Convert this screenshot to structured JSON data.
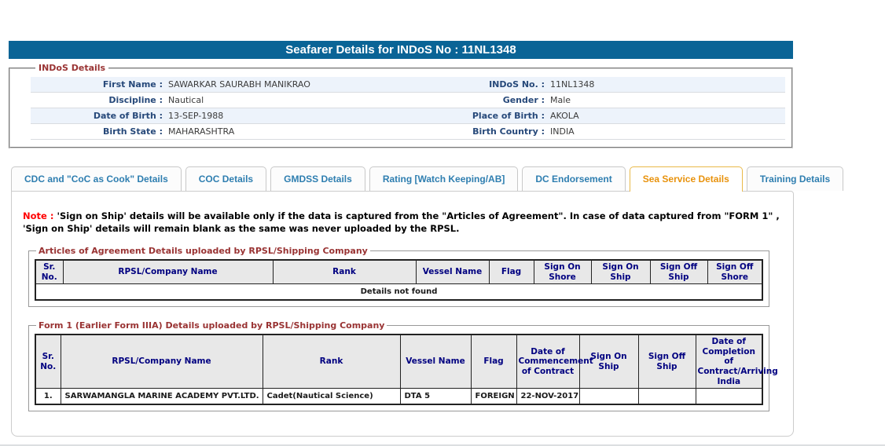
{
  "page": {
    "title": "Seafarer Details for INDoS No : 11NL1348"
  },
  "indos_details": {
    "legend": "INDoS Details",
    "rows": [
      {
        "left_label": "First Name :",
        "left_value": "SAWARKAR SAURABH MANIKRAO",
        "right_label": "INDoS No. :",
        "right_value": "11NL1348"
      },
      {
        "left_label": "Discipline :",
        "left_value": "Nautical",
        "right_label": "Gender :",
        "right_value": "Male"
      },
      {
        "left_label": "Date of Birth :",
        "left_value": "13-SEP-1988",
        "right_label": "Place of Birth :",
        "right_value": "AKOLA"
      },
      {
        "left_label": "Birth State :",
        "left_value": "MAHARASHTRA",
        "right_label": "Birth Country :",
        "right_value": "INDIA"
      }
    ]
  },
  "tabs": [
    {
      "label": "CDC and \"CoC as Cook\" Details",
      "active": false
    },
    {
      "label": "COC Details",
      "active": false
    },
    {
      "label": "GMDSS Details",
      "active": false
    },
    {
      "label": "Rating [Watch Keeping/AB]",
      "active": false
    },
    {
      "label": "DC Endorsement",
      "active": false
    },
    {
      "label": "Sea Service Details",
      "active": true
    },
    {
      "label": "Training Details",
      "active": false
    }
  ],
  "note": {
    "prefix": "Note : ",
    "text": "'Sign on Ship' details will be available only if the data is captured from the \"Articles of Agreement\". In case of data captured from \"FORM 1\" , 'Sign on Ship' details will remain blank as the same was never uploaded by the RPSL."
  },
  "articles_table": {
    "legend": "Articles of Agreement Details uploaded by RPSL/Shipping Company",
    "headers": [
      "Sr. No.",
      "RPSL/Company Name",
      "Rank",
      "Vessel Name",
      "Flag",
      "Sign On Shore",
      "Sign On Ship",
      "Sign Off Ship",
      "Sign Off Shore"
    ],
    "rows": [],
    "empty_message": "Details not found"
  },
  "form1_table": {
    "legend": "Form 1 (Earlier Form IIIA) Details uploaded by RPSL/Shipping Company",
    "headers": [
      "Sr. No.",
      "RPSL/Company Name",
      "Rank",
      "Vessel Name",
      "Flag",
      "Date of Commencement of Contract",
      "Sign On Ship",
      "Sign Off Ship",
      "Date of Completion of Contract/Arriving India"
    ],
    "rows": [
      [
        "1.",
        "SARWAMANGLA MARINE ACADEMY PVT.LTD.",
        "Cadet(Nautical Science)",
        "DTA 5",
        "FOREIGN",
        "22-NOV-2017",
        "",
        "",
        ""
      ]
    ]
  },
  "colors": {
    "header_bar": "#0a6496",
    "tab_text": "#2e7eb0",
    "active_tab_text": "#e8920c",
    "active_tab_border": "#e9b949",
    "legend_text": "#993333",
    "label_text": "#27497a",
    "red_text": "#ee0000",
    "table_header_text": "#000080",
    "alt_row_bg": "#edf3fb"
  }
}
